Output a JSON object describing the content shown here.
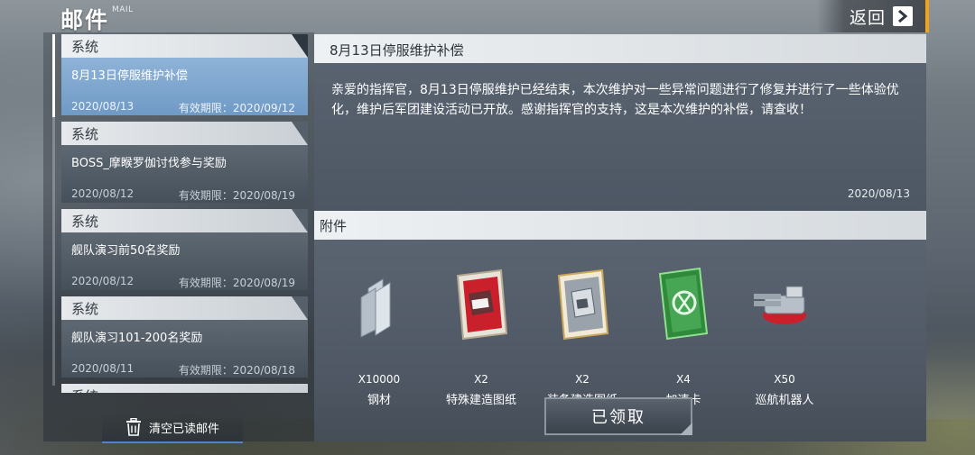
{
  "header": {
    "title": "邮件",
    "subtitle": "MAIL",
    "back_label": "返回"
  },
  "mail_list": {
    "items": [
      {
        "category": "系统",
        "subject": "8月13日停服维护补偿",
        "date": "2020/08/13",
        "expiry": "有效期限：2020/09/12",
        "selected": true
      },
      {
        "category": "系统",
        "subject": "BOSS_摩睺罗伽讨伐参与奖励",
        "date": "2020/08/12",
        "expiry": "有效期限：2020/08/19"
      },
      {
        "category": "系统",
        "subject": "舰队演习前50名奖励",
        "date": "2020/08/12",
        "expiry": "有效期限：2020/08/19"
      },
      {
        "category": "系统",
        "subject": "舰队演习101-200名奖励",
        "date": "2020/08/11",
        "expiry": "有效期限：2020/08/18"
      },
      {
        "category": "系统"
      }
    ],
    "clear_read_label": "清空已读邮件"
  },
  "detail": {
    "title": "8月13日停服维护补偿",
    "body": "亲爱的指挥官，8月13日停服维护已经结束，本次维护对一些异常问题进行了修复并进行了一些体验优化，维护后军团建设活动已开放。感谢指挥官的支持，这是本次维护的补偿，请查收！",
    "date": "2020/08/13",
    "attachments_label": "附件",
    "attachments": [
      {
        "qty": "X10000",
        "name": "钢材",
        "icon": "steel-icon"
      },
      {
        "qty": "X2",
        "name": "特殊建造图纸",
        "icon": "special-blueprint-icon"
      },
      {
        "qty": "X2",
        "name": "装备建造图纸",
        "icon": "equipment-blueprint-icon"
      },
      {
        "qty": "X4",
        "name": "加速卡",
        "icon": "speedup-card-icon"
      },
      {
        "qty": "X50",
        "name": "巡航机器人",
        "icon": "cruise-robot-icon"
      }
    ],
    "claim_label": "已领取"
  }
}
